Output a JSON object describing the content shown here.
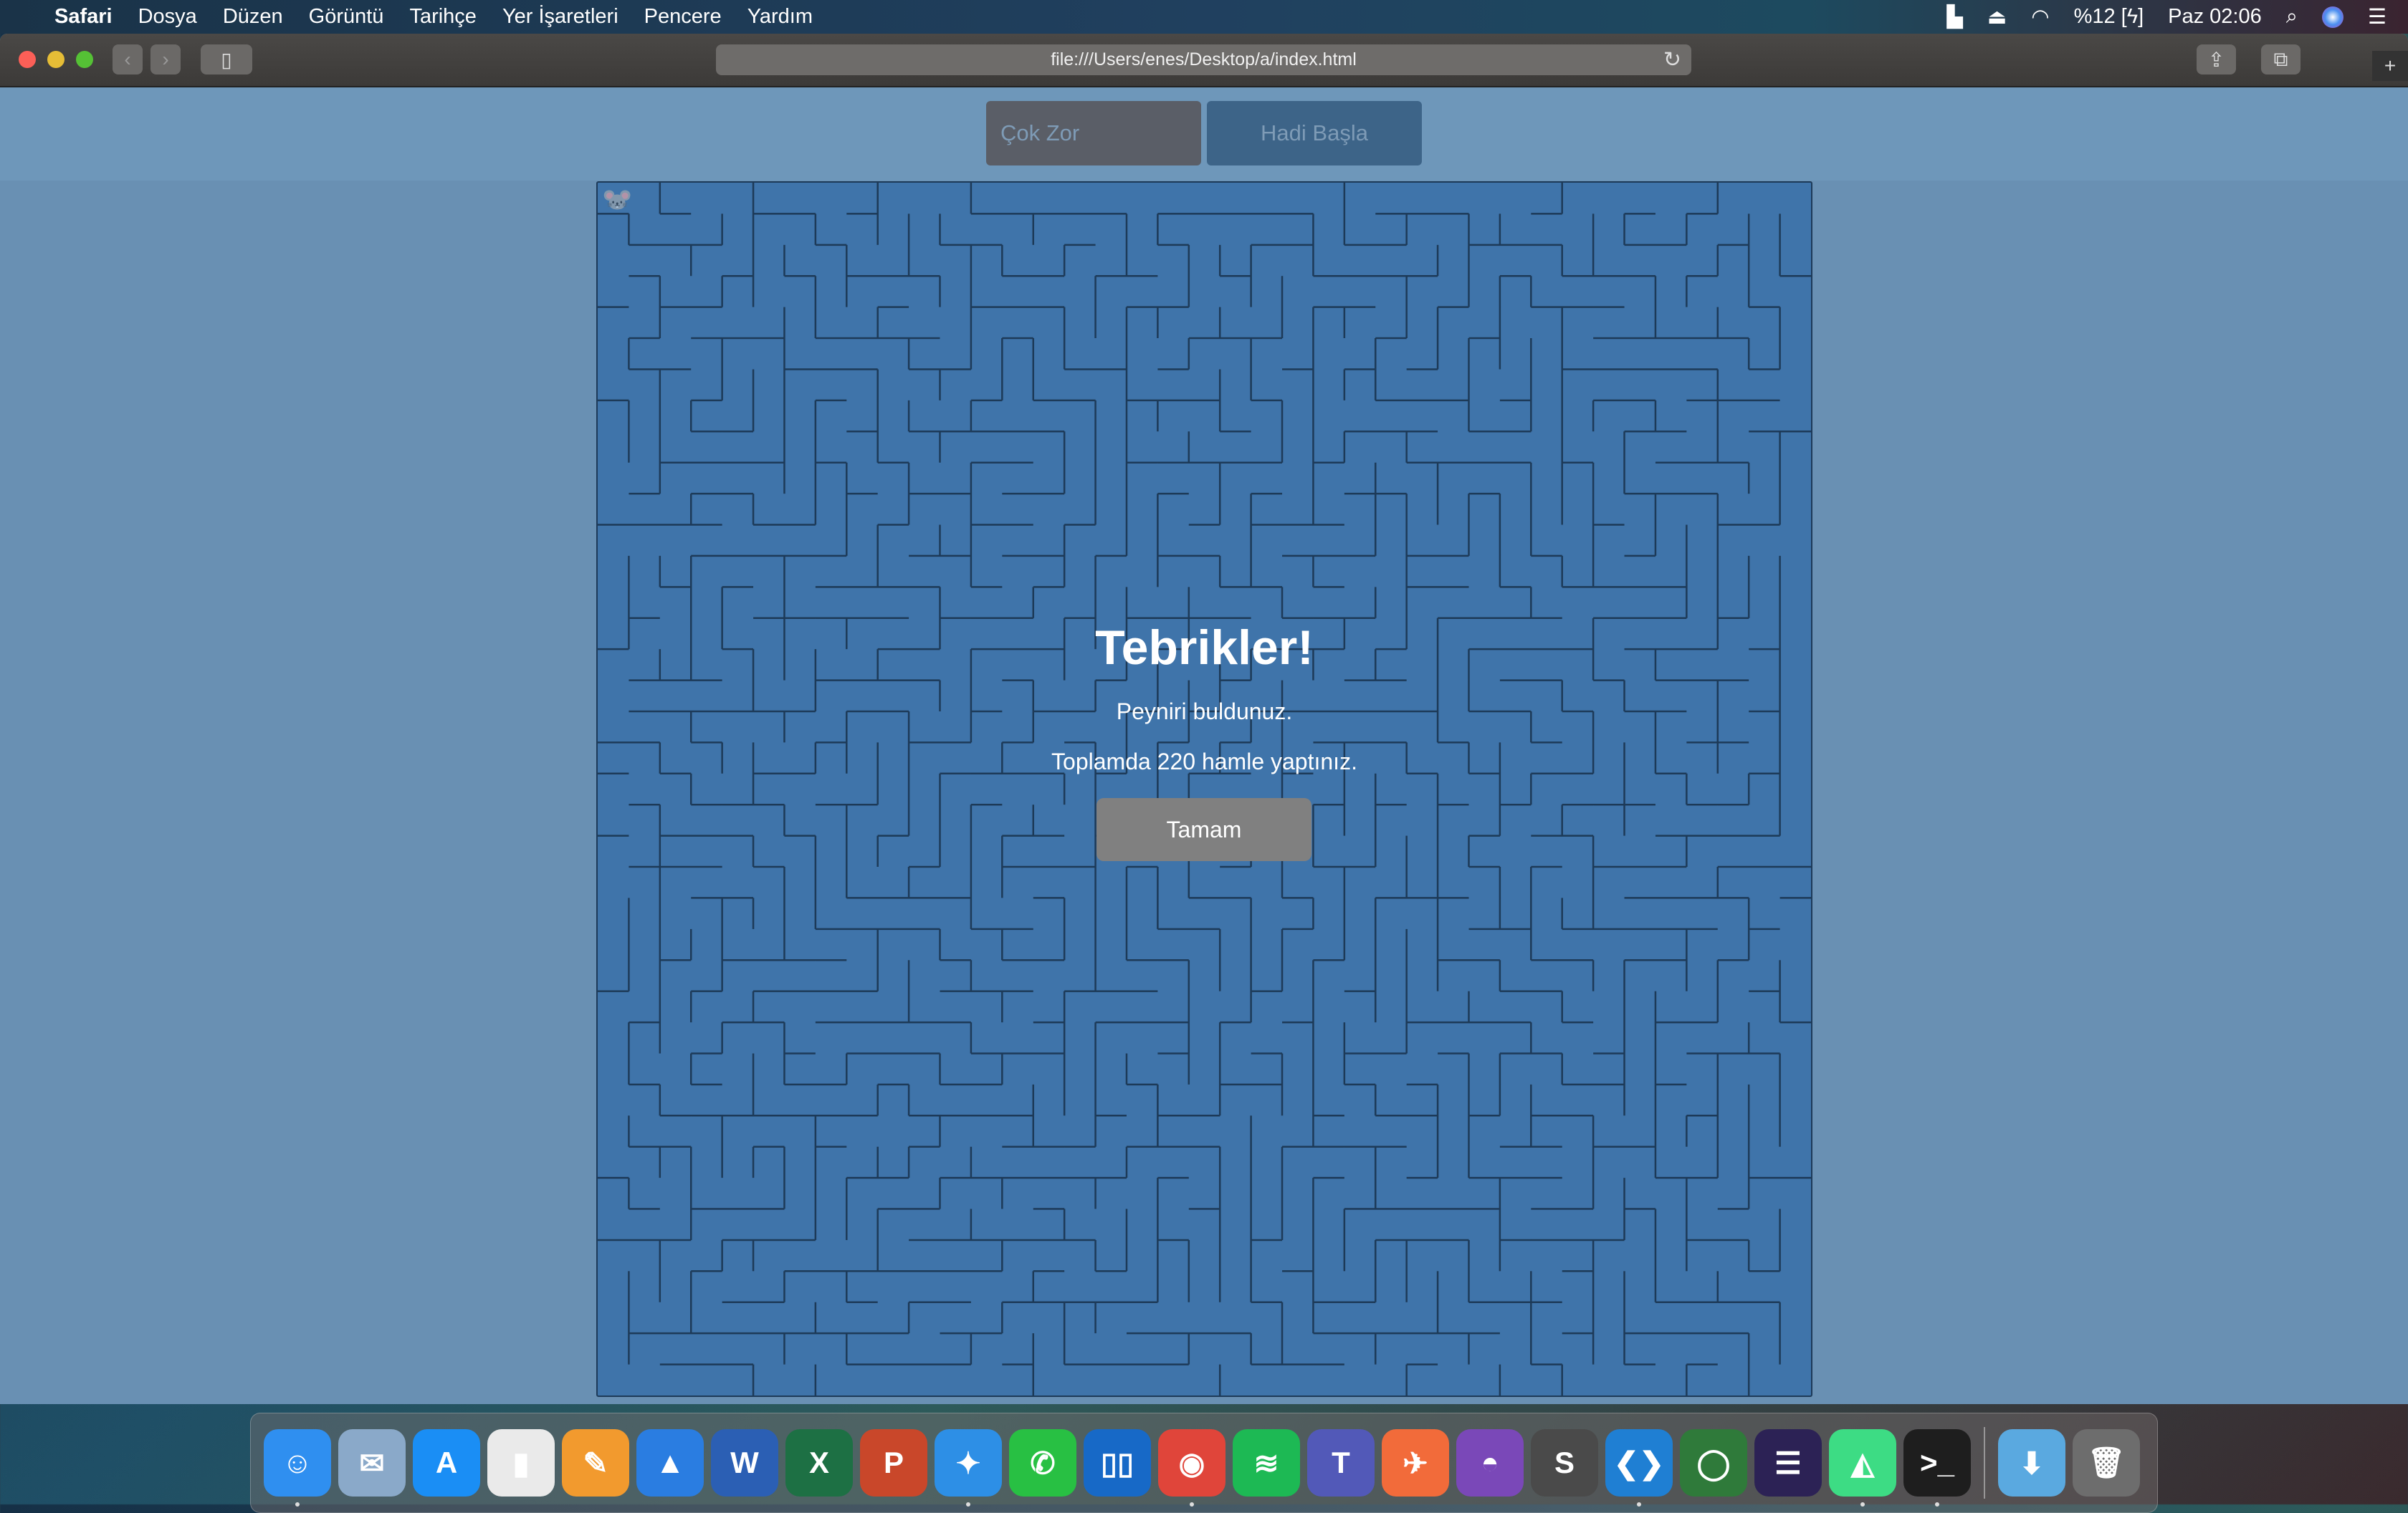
{
  "menubar": {
    "apple": "",
    "app": "Safari",
    "items": [
      "Dosya",
      "Düzen",
      "Görüntü",
      "Tarihçe",
      "Yer İşaretleri",
      "Pencere",
      "Yardım"
    ],
    "battery": "%12",
    "clock": "Paz 02:06"
  },
  "browser": {
    "url": "file:///Users/enes/Desktop/a/index.html"
  },
  "game": {
    "level": "Çok Zor",
    "start": "Hadi Başla"
  },
  "dialog": {
    "title": "Tebrikler!",
    "message": "Peyniri buldunuz.",
    "moves": "Toplamda 220 hamle yaptınız.",
    "ok": "Tamam"
  },
  "colors": {
    "maze_bg": "#3f74aa",
    "maze_wall": "#1d3a58",
    "page_bg": "#6990b3"
  },
  "dock": [
    {
      "name": "finder",
      "label": "☺",
      "color": "#2f8ff0",
      "running": true
    },
    {
      "name": "mail",
      "label": "✉",
      "color": "#8aa9c9"
    },
    {
      "name": "app-store",
      "label": "A",
      "color": "#1a8ef5"
    },
    {
      "name": "numbers",
      "label": "▮",
      "color": "#eaeaea"
    },
    {
      "name": "pages",
      "label": "✎",
      "color": "#f29a2e"
    },
    {
      "name": "keynote",
      "label": "▲",
      "color": "#2a7de1"
    },
    {
      "name": "word",
      "label": "W",
      "color": "#2b5fb4"
    },
    {
      "name": "excel",
      "label": "X",
      "color": "#1d7044"
    },
    {
      "name": "powerpoint",
      "label": "P",
      "color": "#c9472a"
    },
    {
      "name": "safari",
      "label": "✦",
      "color": "#2d8fe6",
      "running": true
    },
    {
      "name": "whatsapp",
      "label": "✆",
      "color": "#28c043"
    },
    {
      "name": "trello",
      "label": "▯▯",
      "color": "#1769c7"
    },
    {
      "name": "chrome",
      "label": "◉",
      "color": "#e0453a",
      "running": true
    },
    {
      "name": "spotify",
      "label": "≋",
      "color": "#1db954"
    },
    {
      "name": "teams",
      "label": "T",
      "color": "#5259b8"
    },
    {
      "name": "postman",
      "label": "✈",
      "color": "#f26b3a"
    },
    {
      "name": "github-desktop",
      "label": "◓",
      "color": "#7a48b8"
    },
    {
      "name": "sublime-text",
      "label": "S",
      "color": "#4a4a4a"
    },
    {
      "name": "vscode",
      "label": "❮❯",
      "color": "#1f7fd3",
      "running": true
    },
    {
      "name": "green-ring-app",
      "label": "◯",
      "color": "#2f7a3a"
    },
    {
      "name": "eclipse",
      "label": "☰",
      "color": "#2c2255"
    },
    {
      "name": "android-studio",
      "label": "◭",
      "color": "#3ddc84",
      "running": true
    },
    {
      "name": "terminal",
      "label": ">_",
      "color": "#1e1e1e",
      "running": true
    },
    {
      "name": "downloads",
      "label": "⬇",
      "color": "#5aa9e0"
    },
    {
      "name": "trash",
      "label": "🗑",
      "color": "#6d6d6d"
    }
  ]
}
